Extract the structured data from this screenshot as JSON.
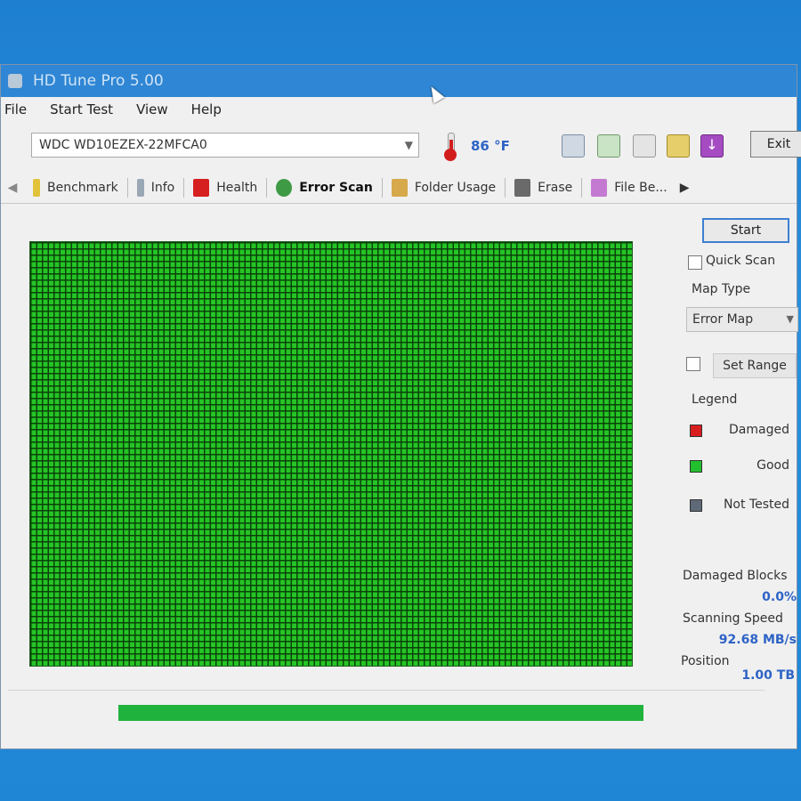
{
  "window": {
    "title": "HD Tune Pro 5.00"
  },
  "menu": [
    "File",
    "Start Test",
    "View",
    "Help"
  ],
  "drive": {
    "model": "WDC WD10EZEX-22MFCA0"
  },
  "temperature": "86 °F",
  "toolbar": {
    "exit_label": "Exit"
  },
  "tabs": [
    {
      "label": "Benchmark",
      "icon": "benchmark-icon"
    },
    {
      "label": "Info",
      "icon": "info-icon"
    },
    {
      "label": "Health",
      "icon": "health-cross-icon"
    },
    {
      "label": "Error Scan",
      "icon": "magnifier-icon",
      "active": true
    },
    {
      "label": "Folder Usage",
      "icon": "folder-icon"
    },
    {
      "label": "Erase",
      "icon": "trash-icon"
    },
    {
      "label": "File Be...",
      "icon": "file-benchmark-icon"
    }
  ],
  "panel": {
    "start_label": "Start",
    "quick_scan_label": "Quick Scan",
    "map_type_label": "Map Type",
    "map_type_value": "Error Map",
    "set_range_label": "Set Range",
    "legend_label": "Legend",
    "legend": [
      {
        "label": "Damaged",
        "color": "#d81e1e"
      },
      {
        "label": "Good",
        "color": "#22c02e"
      },
      {
        "label": "Not Tested",
        "color": "#5f6a78"
      }
    ],
    "damaged_blocks_label": "Damaged Blocks",
    "damaged_blocks_value": "0.0%",
    "scanning_speed_label": "Scanning Speed",
    "scanning_speed_value": "92.68 MB/s",
    "position_label": "Position",
    "position_value": "1.00 TB"
  },
  "scan": {
    "state": "complete",
    "map_color": "#25c425"
  },
  "progress": {
    "fraction": 1.0,
    "color": "#1fb33d"
  }
}
